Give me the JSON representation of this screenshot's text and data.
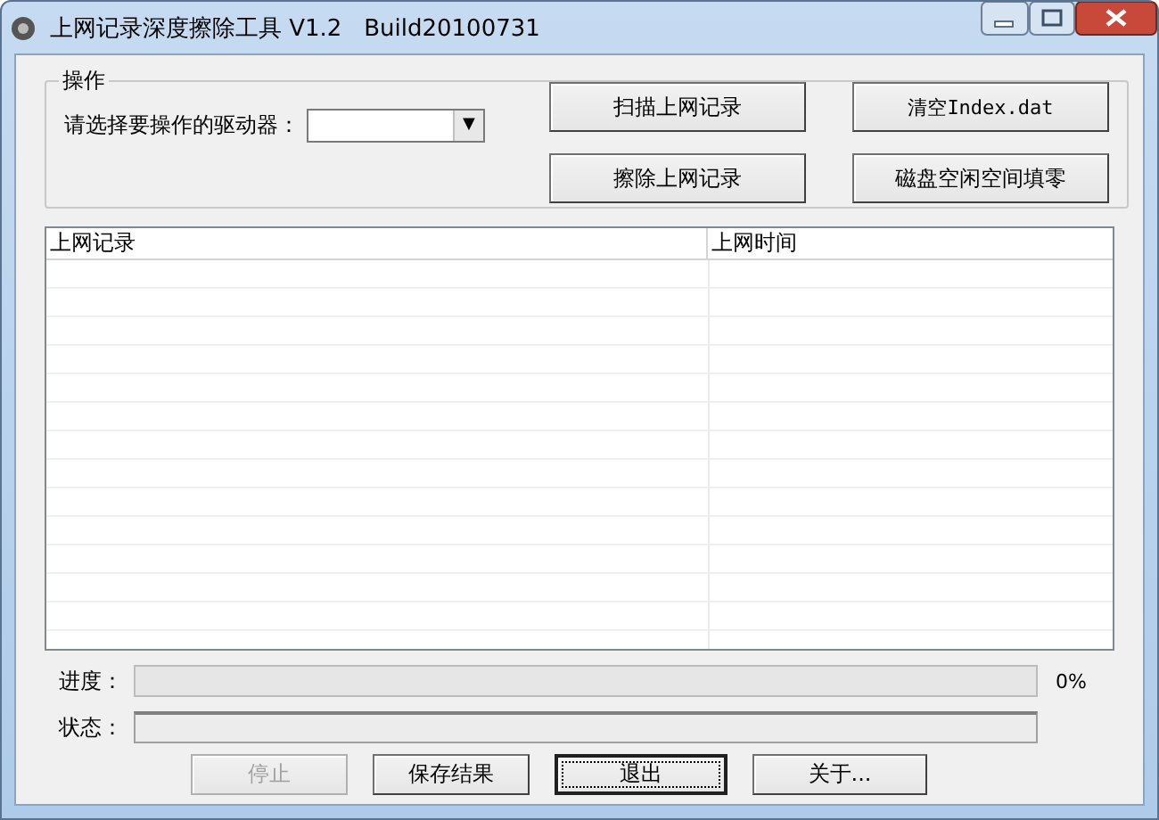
{
  "window": {
    "title": "上网记录深度擦除工具 V1.2",
    "build": "Build20100731"
  },
  "operation_group": {
    "title": "操作",
    "drive_label": "请选择要操作的驱动器：",
    "drive_arrow": "▼"
  },
  "action_buttons": [
    {
      "label": "扫描上网记录"
    },
    {
      "label": "清空Index.dat",
      "kind": "mono"
    },
    {
      "label": "擦除上网记录"
    },
    {
      "label": "磁盘空闲空间填零"
    }
  ],
  "table": {
    "columns": [
      "上网记录",
      "上网时间"
    ]
  },
  "progress": {
    "label": "进度：",
    "level": 0,
    "reading": "0%"
  },
  "status": {
    "label": "状态："
  },
  "buttons": [
    {
      "label": "停止",
      "disabled": true,
      "default": false
    },
    {
      "label": "保存结果",
      "disabled": false,
      "default": false
    },
    {
      "label": "退出",
      "disabled": false,
      "default": true
    },
    {
      "label": "关于...",
      "disabled": false,
      "default": false
    }
  ]
}
